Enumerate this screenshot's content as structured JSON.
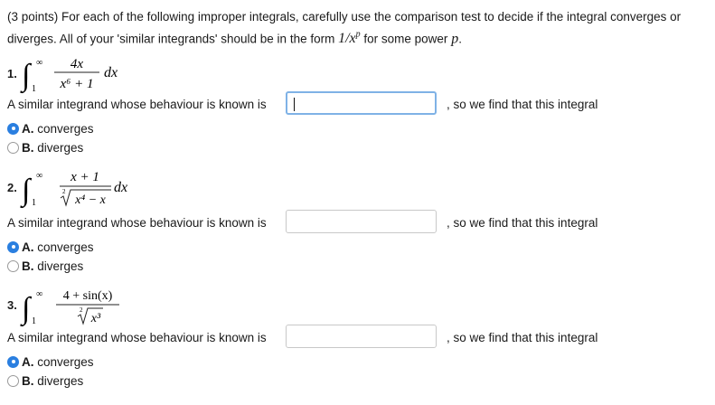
{
  "intro": {
    "text": "(3 points) For each of the following improper integrals, carefully use the comparison test to decide if the integral converges or diverges. All of your 'similar integrands' should be in the form ",
    "form": "1/x",
    "form_sup": "p",
    "middle": " for some power ",
    "power": "p",
    "end": "."
  },
  "problems": [
    {
      "number": "1.",
      "upper": "∞",
      "lower": "1",
      "numerator": "4x",
      "denominator": "x⁶ + 1",
      "differential": "dx",
      "prompt": "A similar integrand whose behaviour is known is",
      "answer_value": "",
      "suffix": ", so we find that this integral",
      "options": [
        {
          "letter": "A.",
          "text": "converges",
          "selected": true
        },
        {
          "letter": "B.",
          "text": "diverges",
          "selected": false
        }
      ]
    },
    {
      "number": "2.",
      "upper": "∞",
      "lower": "1",
      "numerator": "x + 1",
      "root_index": "2",
      "radicand": "x⁴ − x",
      "differential": "dx",
      "prompt": "A similar integrand whose behaviour is known is",
      "answer_value": "",
      "suffix": ", so we find that this integral",
      "options": [
        {
          "letter": "A.",
          "text": "converges",
          "selected": true
        },
        {
          "letter": "B.",
          "text": "diverges",
          "selected": false
        }
      ]
    },
    {
      "number": "3.",
      "upper": "∞",
      "lower": "1",
      "numerator": "4 + sin(x)",
      "root_index": "2",
      "radicand": "x³",
      "prompt": "A similar integrand whose behaviour is known is",
      "answer_value": "",
      "suffix": ", so we find that this integral",
      "options": [
        {
          "letter": "A.",
          "text": "converges",
          "selected": true
        },
        {
          "letter": "B.",
          "text": "diverges",
          "selected": false
        }
      ]
    }
  ],
  "colors": {
    "radio_selected": "#2a7fe0",
    "focus_border": "#7fb2e6"
  }
}
